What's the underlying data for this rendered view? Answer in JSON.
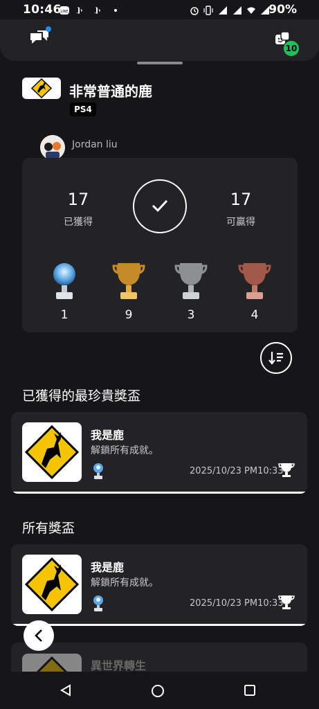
{
  "status": {
    "time": "10:46",
    "battery": "90%"
  },
  "header": {
    "notifications_badge_color": "#1f8cff",
    "friends_count": "10"
  },
  "game": {
    "title": "非常普通的鹿",
    "platform": "PS4"
  },
  "user": {
    "name": "Jordan liu"
  },
  "summary": {
    "earned": "17",
    "earned_label": "已獲得",
    "available": "17",
    "available_label": "可贏得",
    "trophies": [
      {
        "type": "platinum",
        "count": "1"
      },
      {
        "type": "gold",
        "count": "9"
      },
      {
        "type": "silver",
        "count": "3"
      },
      {
        "type": "bronze",
        "count": "4"
      }
    ]
  },
  "sections": {
    "rarest_title": "已獲得的最珍貴獎盃",
    "all_title": "所有獎盃"
  },
  "rarest_trophy": {
    "name": "我是鹿",
    "description": "解鎖所有成就。",
    "date": "2025/10/23  PM10:33"
  },
  "all_trophies": [
    {
      "name": "我是鹿",
      "description": "解鎖所有成就。",
      "date": "2025/10/23  PM10:33"
    },
    {
      "name": "異世界轉生"
    }
  ],
  "colors": {
    "background": "#161618",
    "panel": "#232326",
    "accent_green": "#1fbf5a"
  }
}
